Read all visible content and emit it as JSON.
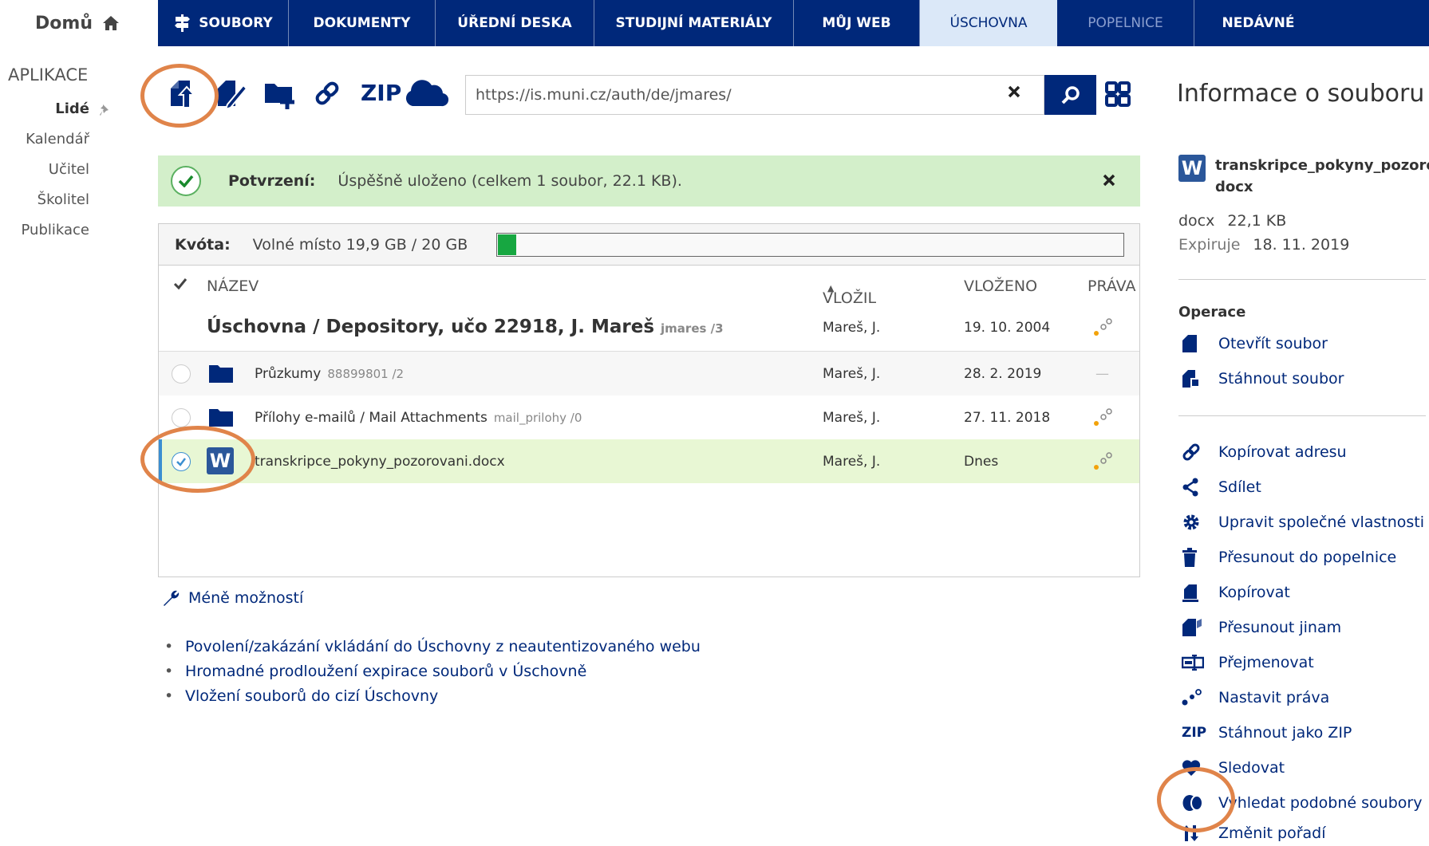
{
  "home": {
    "label": "Domů"
  },
  "nav": {
    "tabs": [
      {
        "label": "SOUBORY",
        "icon": "signpost-icon"
      },
      {
        "label": "DOKUMENTY"
      },
      {
        "label": "ÚŘEDNÍ DESKA"
      },
      {
        "label": "STUDIJNÍ MATERIÁLY"
      },
      {
        "label": "MŮJ WEB"
      },
      {
        "label": "ÚSCHOVNA",
        "active": true
      },
      {
        "label": "POPELNICE",
        "dim": true
      },
      {
        "label": "NEDÁVNÉ"
      }
    ]
  },
  "apps": {
    "title": "APLIKACE",
    "items": [
      "Lidé",
      "Kalendář",
      "Učitel",
      "Školitel",
      "Publikace"
    ]
  },
  "toolbar": {
    "zip_label": "ZIP",
    "url_value": "https://is.muni.cz/auth/de/jmares/"
  },
  "confirm": {
    "label": "Potvrzení:",
    "message": "Úspěšně uloženo (celkem 1 soubor, 22.1 KB)."
  },
  "quota": {
    "label": "Kvóta:",
    "value": "Volné místo 19,9 GB / 20 GB",
    "used_fraction": 0.005
  },
  "table": {
    "headers": {
      "name": "NÁZEV",
      "author": "VLOŽIL",
      "date": "VLOŽENO",
      "rights": "PRÁVA"
    },
    "root": {
      "title": "Úschovna / Depository, učo 22918, J. Mareš",
      "sub": "jmares /3",
      "author": "Mareš, J.",
      "date": "19. 10. 2004"
    },
    "rows": [
      {
        "name": "Průzkumy",
        "sub": "88899801 /2",
        "author": "Mareš, J.",
        "date": "28. 2. 2019",
        "rights": "—"
      },
      {
        "name": "Přílohy e-mailů / Mail Attachments",
        "sub": "mail_prilohy /0",
        "author": "Mareš, J.",
        "date": "27. 11. 2018"
      },
      {
        "name": "transkripce_pokyny_pozorovani.docx",
        "author": "Mareš, J.",
        "date": "Dnes",
        "file_icon": "W"
      }
    ]
  },
  "less_options": "Méně možností",
  "options": [
    "Povolení/zakázání vkládání do Úschovny z neautentizovaného webu",
    "Hromadné prodloužení expirace souborů v Úschovně",
    "Vložení souborů do cizí Úschovny"
  ],
  "info": {
    "title": "Informace o souboru",
    "file_icon": "W",
    "file_name": "transkripce_pokyny_pozorova docx",
    "type": "docx",
    "size": "22,1 KB",
    "expire_label": "Expiruje",
    "expire_value": "18. 11. 2019",
    "ops_title": "Operace",
    "ops_group1": [
      "Otevřít soubor",
      "Stáhnout soubor"
    ],
    "ops_group2": [
      "Kopírovat adresu",
      "Sdílet",
      "Upravit společné vlastnosti",
      "Přesunout do popelnice",
      "Kopírovat",
      "Přesunout jinam",
      "Přejmenovat",
      "Nastavit práva",
      "Stáhnout jako ZIP",
      "Sledovat",
      "Vyhledat podobné soubory",
      "Změnit pořadí"
    ],
    "zip_op_icon": "ZIP"
  },
  "colors": {
    "navy": "#00287a",
    "confirm_bg": "#d3efca",
    "selected_row": "#e8f7d4",
    "annotation": "#e0844a",
    "quota_fill": "#17a741"
  }
}
